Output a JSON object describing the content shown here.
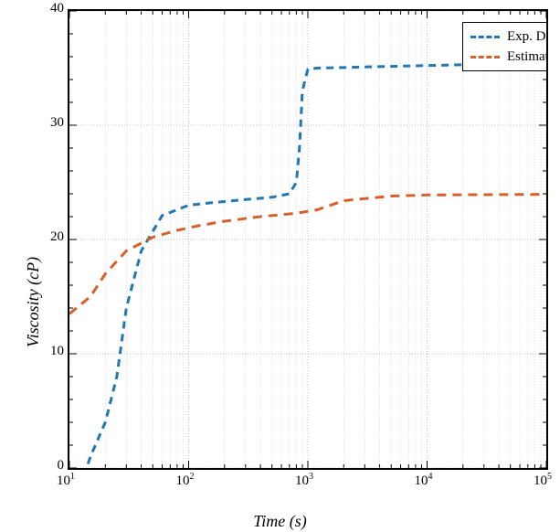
{
  "chart_data": {
    "type": "line",
    "xlabel": "Time (s)",
    "ylabel": "Viscosity (cP)",
    "xscale": "log",
    "xlim": [
      10,
      100000
    ],
    "ylim": [
      0,
      40
    ],
    "x_tick_labels": [
      "10^1",
      "10^2",
      "10^3",
      "10^4",
      "10^5"
    ],
    "y_tick_labels": [
      "0",
      "10",
      "20",
      "30",
      "40"
    ],
    "grid": true,
    "legend_position": "top-right",
    "series": [
      {
        "name": "Exp. Data",
        "color": "#1f77b4",
        "x": [
          10,
          12,
          15,
          20,
          25,
          30,
          40,
          60,
          100,
          150,
          300,
          500,
          700,
          800,
          850,
          900,
          1000,
          1200,
          2000,
          3000,
          5000,
          20000,
          40000,
          100000
        ],
        "y": [
          -5,
          -2,
          1,
          4,
          8,
          14,
          19,
          22.1,
          23,
          23.2,
          23.5,
          23.7,
          24,
          25,
          28,
          33,
          34.9,
          35,
          35.05,
          35.1,
          35.15,
          35.3,
          36.5,
          38
        ],
        "dash": "8,6",
        "width": 3
      },
      {
        "name": "Estimated",
        "color": "#d95f2a",
        "x": [
          10,
          15,
          20,
          30,
          50,
          80,
          120,
          200,
          400,
          800,
          1200,
          2000,
          5000,
          10000,
          100000
        ],
        "y": [
          13.5,
          15,
          17,
          19,
          20.2,
          20.8,
          21.2,
          21.6,
          22,
          22.3,
          22.6,
          23.4,
          23.8,
          23.9,
          23.95
        ],
        "dash": "10,7",
        "width": 3
      }
    ]
  }
}
